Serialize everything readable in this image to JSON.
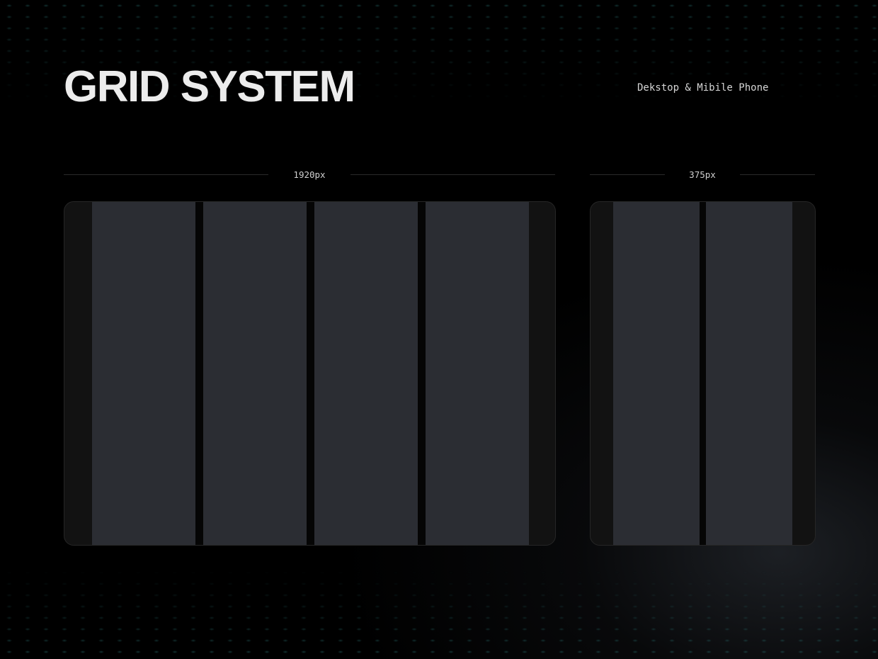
{
  "header": {
    "title": "GRID SYSTEM",
    "subtitle": "Dekstop & Mibile Phone"
  },
  "desktop": {
    "width_label": "1920px",
    "columns": 4
  },
  "mobile": {
    "width_label": "375px",
    "columns": 2
  },
  "colors": {
    "background": "#000000",
    "column": "#2b2d33",
    "margin": "#121212",
    "gutter": "#050505",
    "title": "#ececec",
    "dot_accent": "#286e6e"
  }
}
